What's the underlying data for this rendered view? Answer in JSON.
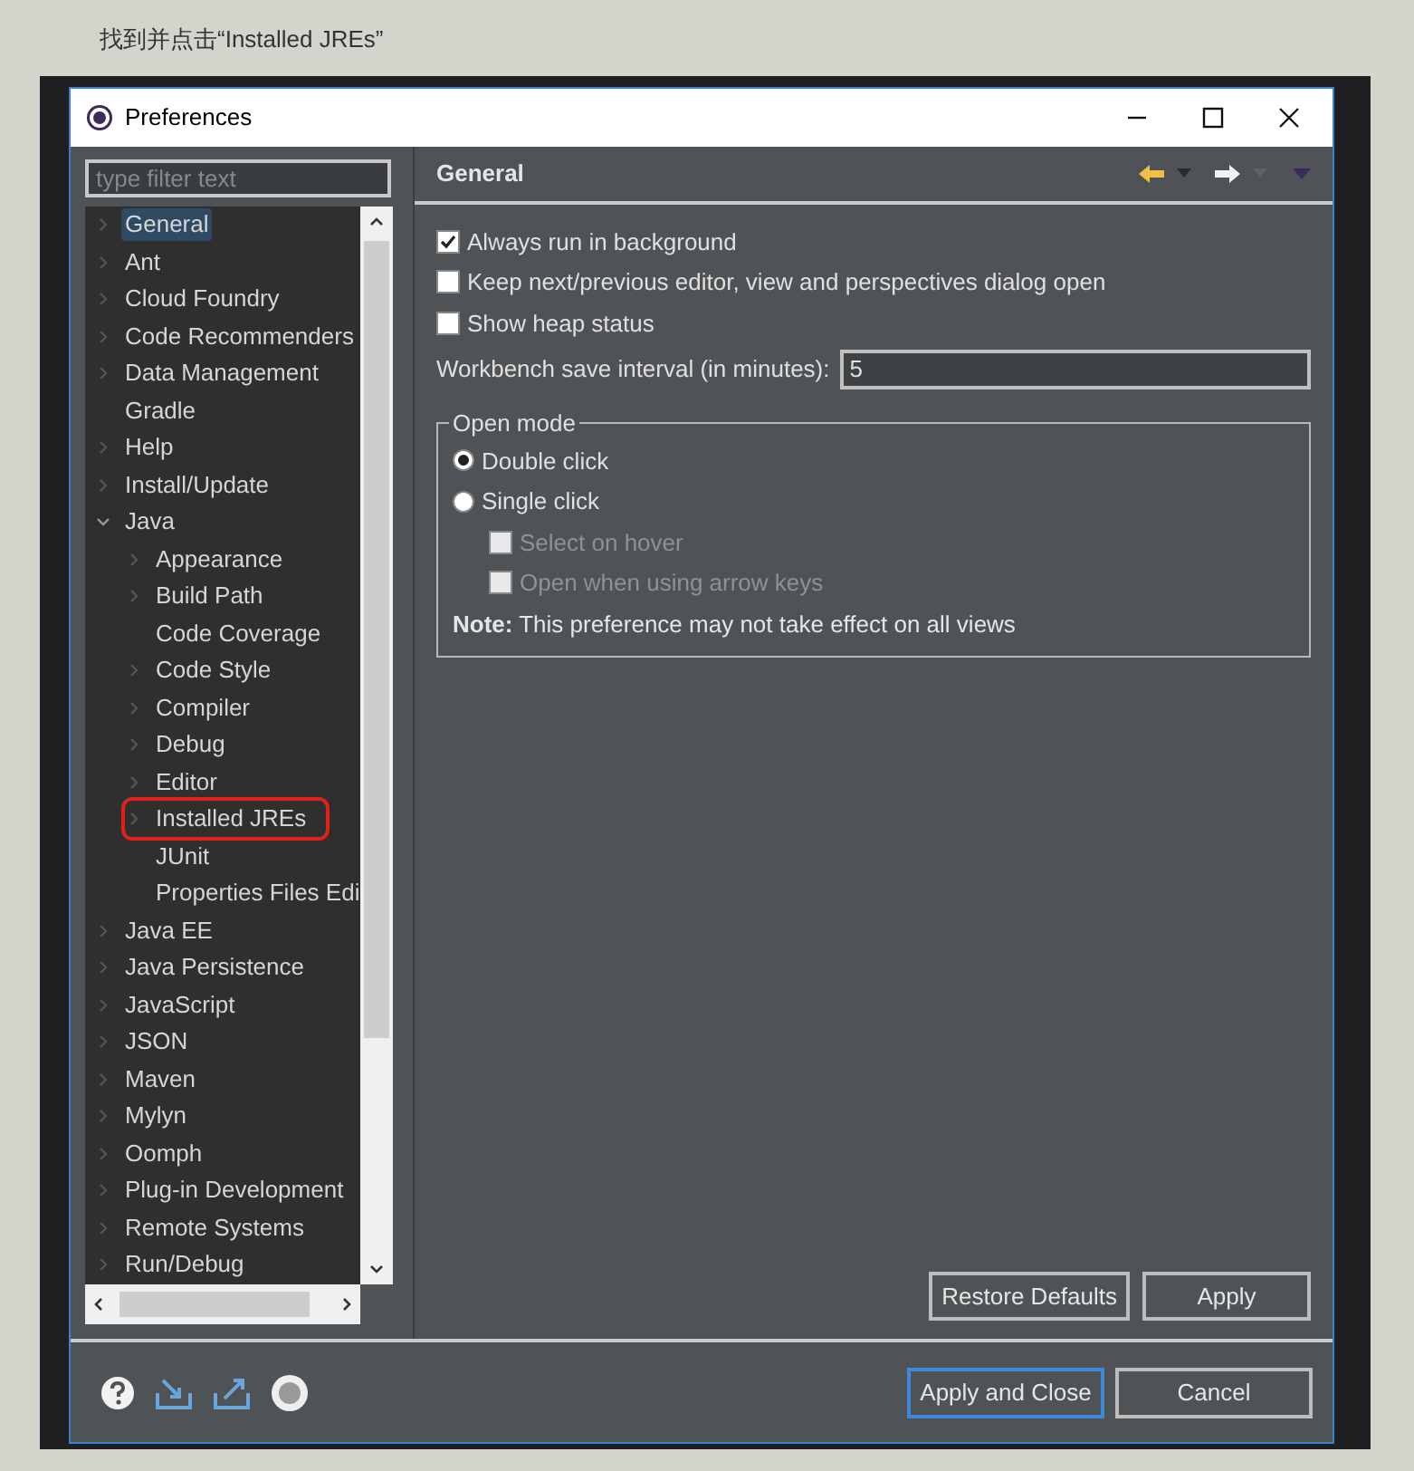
{
  "caption": "找到并点击“Installed JREs”",
  "window": {
    "title": "Preferences"
  },
  "filter": {
    "placeholder": "type filter text"
  },
  "tree": [
    {
      "label": "General",
      "kind": "branch",
      "expanded": false,
      "selected": true,
      "highlighted": false
    },
    {
      "label": "Ant",
      "kind": "branch",
      "expanded": false,
      "selected": false,
      "highlighted": false
    },
    {
      "label": "Cloud Foundry",
      "kind": "branch",
      "expanded": false,
      "selected": false,
      "highlighted": false
    },
    {
      "label": "Code Recommenders",
      "kind": "branch",
      "expanded": false,
      "selected": false,
      "highlighted": false
    },
    {
      "label": "Data Management",
      "kind": "branch",
      "expanded": false,
      "selected": false,
      "highlighted": false
    },
    {
      "label": "Gradle",
      "kind": "leaf",
      "selected": false,
      "highlighted": false
    },
    {
      "label": "Help",
      "kind": "branch",
      "expanded": false,
      "selected": false,
      "highlighted": false
    },
    {
      "label": "Install/Update",
      "kind": "branch",
      "expanded": false,
      "selected": false,
      "highlighted": false
    },
    {
      "label": "Java",
      "kind": "branch",
      "expanded": true,
      "selected": false,
      "highlighted": false,
      "children": [
        {
          "label": "Appearance",
          "kind": "branch",
          "expanded": false,
          "selected": false,
          "highlighted": false
        },
        {
          "label": "Build Path",
          "kind": "branch",
          "expanded": false,
          "selected": false,
          "highlighted": false
        },
        {
          "label": "Code Coverage",
          "kind": "leaf",
          "selected": false,
          "highlighted": false
        },
        {
          "label": "Code Style",
          "kind": "branch",
          "expanded": false,
          "selected": false,
          "highlighted": false
        },
        {
          "label": "Compiler",
          "kind": "branch",
          "expanded": false,
          "selected": false,
          "highlighted": false
        },
        {
          "label": "Debug",
          "kind": "branch",
          "expanded": false,
          "selected": false,
          "highlighted": false
        },
        {
          "label": "Editor",
          "kind": "branch",
          "expanded": false,
          "selected": false,
          "highlighted": false
        },
        {
          "label": "Installed JREs",
          "kind": "branch",
          "expanded": false,
          "selected": false,
          "highlighted": true
        },
        {
          "label": "JUnit",
          "kind": "leaf",
          "selected": false,
          "highlighted": false
        },
        {
          "label": "Properties Files Edi",
          "kind": "leaf",
          "selected": false,
          "highlighted": false
        }
      ]
    },
    {
      "label": "Java EE",
      "kind": "branch",
      "expanded": false,
      "selected": false,
      "highlighted": false
    },
    {
      "label": "Java Persistence",
      "kind": "branch",
      "expanded": false,
      "selected": false,
      "highlighted": false
    },
    {
      "label": "JavaScript",
      "kind": "branch",
      "expanded": false,
      "selected": false,
      "highlighted": false
    },
    {
      "label": "JSON",
      "kind": "branch",
      "expanded": false,
      "selected": false,
      "highlighted": false
    },
    {
      "label": "Maven",
      "kind": "branch",
      "expanded": false,
      "selected": false,
      "highlighted": false
    },
    {
      "label": "Mylyn",
      "kind": "branch",
      "expanded": false,
      "selected": false,
      "highlighted": false
    },
    {
      "label": "Oomph",
      "kind": "branch",
      "expanded": false,
      "selected": false,
      "highlighted": false
    },
    {
      "label": "Plug-in Development",
      "kind": "branch",
      "expanded": false,
      "selected": false,
      "highlighted": false
    },
    {
      "label": "Remote Systems",
      "kind": "branch",
      "expanded": false,
      "selected": false,
      "highlighted": false
    },
    {
      "label": "Run/Debug",
      "kind": "branch",
      "expanded": false,
      "selected": false,
      "highlighted": false
    }
  ],
  "page": {
    "title": "General",
    "options": [
      {
        "label": "Always run in background",
        "checked": true
      },
      {
        "label": "Keep next/previous editor, view and perspectives dialog open",
        "checked": false
      },
      {
        "label": "Show heap status",
        "checked": false
      }
    ],
    "save_interval": {
      "label": "Workbench save interval (in minutes):",
      "value": "5"
    },
    "open_mode": {
      "title": "Open mode",
      "modes": [
        {
          "label": "Double click",
          "selected": true
        },
        {
          "label": "Single click",
          "selected": false
        }
      ],
      "sub_options": [
        {
          "label": "Select on hover",
          "checked": false,
          "disabled": true
        },
        {
          "label": "Open when using arrow keys",
          "checked": false,
          "disabled": true
        }
      ],
      "note": "**Note:** This preference may not take effect on all views"
    },
    "buttons": [
      "Restore Defaults",
      "Apply"
    ]
  },
  "footer_buttons": [
    {
      "label": "Apply and Close",
      "default": true
    },
    {
      "label": "Cancel",
      "default": false
    }
  ]
}
